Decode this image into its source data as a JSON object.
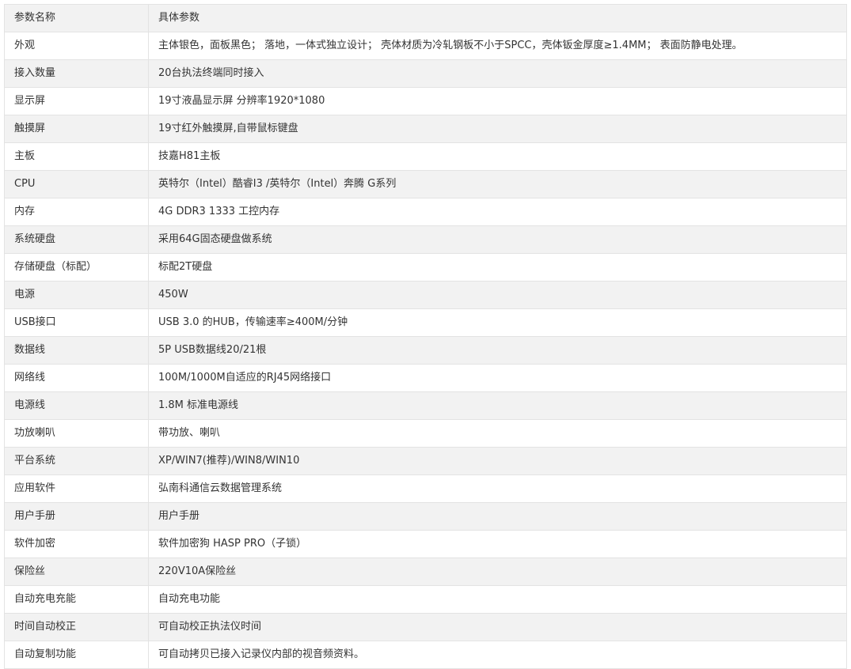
{
  "table": {
    "header": [
      "参数名称",
      "具体参数"
    ],
    "rows": [
      [
        "外观",
        "主体银色，面板黑色； 落地，一体式独立设计； 壳体材质为冷轧钢板不小于SPCC，壳体钣金厚度≥1.4MM； 表面防静电处理。"
      ],
      [
        "接入数量",
        "20台执法终端同时接入"
      ],
      [
        "显示屏",
        "19寸液晶显示屏  分辨率1920*1080"
      ],
      [
        "触摸屏",
        "19寸红外触摸屏,自带鼠标键盘"
      ],
      [
        "主板",
        "技嘉H81主板"
      ],
      [
        "CPU",
        "英特尔（Intel）酷睿I3 /英特尔（Intel）奔腾 G系列"
      ],
      [
        "内存",
        "4G DDR3 1333 工控内存"
      ],
      [
        "系统硬盘",
        "采用64G固态硬盘做系统"
      ],
      [
        "存储硬盘（标配）",
        "标配2T硬盘"
      ],
      [
        "电源",
        "450W"
      ],
      [
        "USB接口",
        "USB 3.0 的HUB，传输速率≥400M/分钟"
      ],
      [
        "数据线",
        "5P USB数据线20/21根"
      ],
      [
        "网络线",
        "100M/1000M自适应的RJ45网络接口"
      ],
      [
        "电源线",
        "1.8M 标准电源线"
      ],
      [
        "功放喇叭",
        "带功放、喇叭"
      ],
      [
        "平台系统",
        "XP/WIN7(推荐)/WIN8/WIN10"
      ],
      [
        "应用软件",
        "弘南科通信云数据管理系统"
      ],
      [
        "用户手册",
        "用户手册"
      ],
      [
        "软件加密",
        "软件加密狗 HASP PRO（子锁）"
      ],
      [
        "保险丝",
        "220V10A保险丝"
      ],
      [
        "自动充电充能",
        "自动充电功能"
      ],
      [
        "时间自动校正",
        "可自动校正执法仪时间"
      ],
      [
        "自动复制功能",
        "可自动拷贝已接入记录仪内部的视音频资料。"
      ]
    ]
  }
}
